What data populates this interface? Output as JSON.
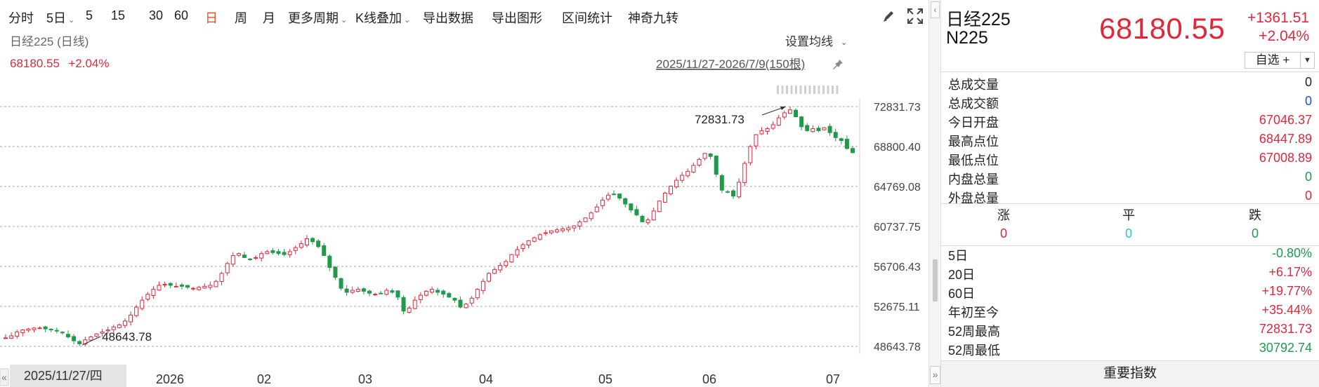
{
  "toolbar": {
    "items": [
      {
        "label": "分时",
        "active": false,
        "caret": false
      },
      {
        "label": "5日",
        "active": false,
        "caret": true
      },
      {
        "label": "5",
        "active": false,
        "caret": false
      },
      {
        "label": "15",
        "active": false,
        "caret": false
      },
      {
        "label": "30",
        "active": false,
        "caret": false
      },
      {
        "label": "60",
        "active": false,
        "caret": false
      },
      {
        "label": "日",
        "active": true,
        "caret": false
      },
      {
        "label": "周",
        "active": false,
        "caret": false
      },
      {
        "label": "月",
        "active": false,
        "caret": false
      },
      {
        "label": "更多周期",
        "active": false,
        "caret": true
      },
      {
        "label": "K线叠加",
        "active": false,
        "caret": true
      },
      {
        "label": "导出数据",
        "active": false,
        "caret": false
      },
      {
        "label": "导出图形",
        "active": false,
        "caret": false
      },
      {
        "label": "区间统计",
        "active": false,
        "caret": false
      },
      {
        "label": "神奇九转",
        "active": false,
        "caret": false
      }
    ],
    "icons": [
      "pen-icon",
      "fullscreen-icon"
    ]
  },
  "chart": {
    "legend_name": "日经225 (日线)",
    "legend_price": "68180.55",
    "legend_change": "+2.04%",
    "set_ma_label": "设置均线",
    "date_range": "2025/11/27-2026/7/9(150根)",
    "high_annotation": "72831.73",
    "low_annotation": "48643.78",
    "cursor_date": "2025/11/27/四",
    "y_ticks": [
      "72831.73",
      "68800.40",
      "64769.08",
      "60737.75",
      "56706.43",
      "52675.11",
      "48643.78"
    ],
    "x_ticks": [
      "2026",
      "02",
      "03",
      "04",
      "05",
      "06",
      "07"
    ]
  },
  "chart_data": {
    "type": "candlestick",
    "title": "日经225 (日线)",
    "range": "2025/11/27-2026/7/9(150根)",
    "ylim": [
      48643.78,
      72831.73
    ],
    "y_ticks": [
      72831.73,
      68800.4,
      64769.08,
      60737.75,
      56706.43,
      52675.11,
      48643.78
    ],
    "x_ticks": [
      "2026",
      "02",
      "03",
      "04",
      "05",
      "06",
      "07"
    ],
    "period_high": 72831.73,
    "period_low": 48643.78,
    "close_approx": [
      49500,
      49700,
      50100,
      50300,
      50400,
      50500,
      50500,
      50400,
      50300,
      50200,
      50000,
      49600,
      49200,
      48900,
      49300,
      49600,
      49900,
      50100,
      50300,
      50600,
      50800,
      51200,
      51800,
      52600,
      53300,
      53900,
      54400,
      54800,
      54900,
      54800,
      54700,
      54700,
      54600,
      54500,
      54600,
      54700,
      54800,
      55200,
      56000,
      57000,
      57800,
      58000,
      57600,
      57400,
      57600,
      58000,
      58200,
      58100,
      58000,
      57900,
      58200,
      58600,
      59000,
      59500,
      59200,
      58700,
      57800,
      56600,
      55600,
      54500,
      54100,
      54300,
      54400,
      54200,
      54000,
      53900,
      54000,
      54300,
      54100,
      53600,
      52200,
      52500,
      53300,
      53800,
      54200,
      54400,
      54100,
      53900,
      53600,
      53300,
      52600,
      52900,
      53500,
      54400,
      55200,
      56000,
      56400,
      56800,
      57200,
      57900,
      58400,
      58900,
      59300,
      59600,
      59900,
      60100,
      60300,
      60400,
      60500,
      60600,
      60800,
      61200,
      61600,
      62100,
      62700,
      63400,
      63900,
      64000,
      63600,
      63000,
      62400,
      61900,
      61200,
      61400,
      62300,
      63300,
      64100,
      64800,
      65400,
      65900,
      66300,
      66900,
      67500,
      68100,
      67800,
      66000,
      64400,
      64200,
      63800,
      65200,
      67100,
      68800,
      70000,
      70400,
      70600,
      71000,
      71700,
      72200,
      72500,
      71800,
      70800,
      70400,
      70600,
      70400,
      70700,
      70200,
      69700,
      69400,
      68600,
      68180.55
    ]
  },
  "quote": {
    "name": "日经225",
    "code": "N225",
    "price": "68180.55",
    "change": "+1361.51",
    "change_pct": "+2.04%",
    "watch_label": "自选 +",
    "stats": [
      {
        "label": "总成交量",
        "value": "0",
        "color": "black"
      },
      {
        "label": "总成交额",
        "value": "0",
        "color": "blue"
      },
      {
        "label": "今日开盘",
        "value": "67046.37",
        "color": "red"
      },
      {
        "label": "最高点位",
        "value": "68447.89",
        "color": "red"
      },
      {
        "label": "最低点位",
        "value": "67008.89",
        "color": "red"
      },
      {
        "label": "内盘总量",
        "value": "0",
        "color": "green"
      },
      {
        "label": "外盘总量",
        "value": "0",
        "color": "red"
      }
    ],
    "breadth": {
      "up_label": "涨",
      "flat_label": "平",
      "down_label": "跌",
      "up": "0",
      "flat": "0",
      "down": "0"
    },
    "periods": [
      {
        "label": "5日",
        "value": "-0.80%",
        "color": "green"
      },
      {
        "label": "20日",
        "value": "+6.17%",
        "color": "red"
      },
      {
        "label": "60日",
        "value": "+19.77%",
        "color": "red"
      },
      {
        "label": "年初至今",
        "value": "+35.44%",
        "color": "red"
      },
      {
        "label": "52周最高",
        "value": "72831.73",
        "color": "red"
      },
      {
        "label": "52周最低",
        "value": "30792.74",
        "color": "green"
      }
    ],
    "bottom_button": "重要指数"
  },
  "colors": {
    "up": "#e0283a",
    "down": "#1f9a4a",
    "active": "#e8501f",
    "gridline": "#a8a8a8"
  }
}
